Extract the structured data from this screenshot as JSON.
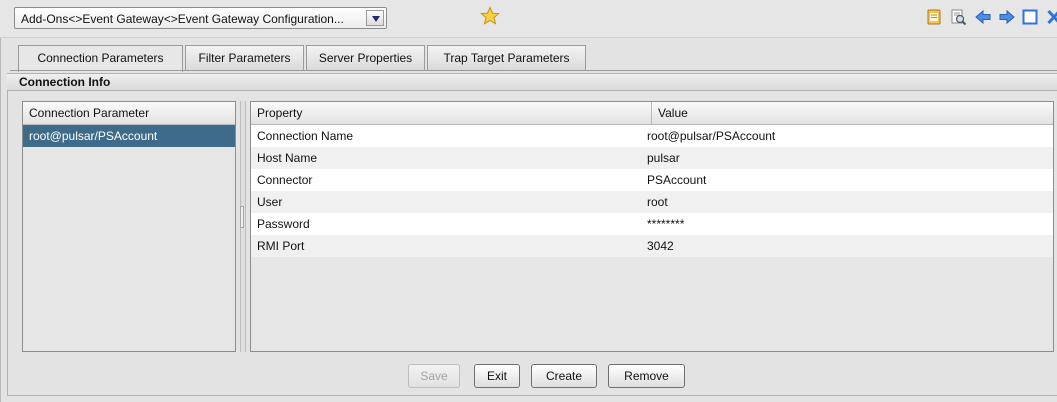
{
  "toolbar": {
    "breadcrumb": "Add-Ons<>Event Gateway<>Event Gateway Configuration...",
    "icons": [
      "star-icon",
      "notepad-icon",
      "print-preview-icon",
      "back-arrow-icon",
      "forward-arrow-icon",
      "maximize-icon",
      "close-icon"
    ]
  },
  "tabs": [
    {
      "label": "Connection Parameters",
      "active": true
    },
    {
      "label": "Filter Parameters",
      "active": false
    },
    {
      "label": "Server Properties",
      "active": false
    },
    {
      "label": "Trap Target Parameters",
      "active": false
    }
  ],
  "section": {
    "title": "Connection Info"
  },
  "left_list": {
    "header": "Connection Parameter",
    "items": [
      "root@pulsar/PSAccount"
    ],
    "selected": "root@pulsar/PSAccount"
  },
  "table": {
    "columns": [
      "Property",
      "Value"
    ],
    "rows": [
      {
        "property": "Connection Name",
        "value": "root@pulsar/PSAccount"
      },
      {
        "property": "Host Name",
        "value": "pulsar"
      },
      {
        "property": "Connector",
        "value": "PSAccount"
      },
      {
        "property": "User",
        "value": "root"
      },
      {
        "property": "Password",
        "value": "********"
      },
      {
        "property": "RMI Port",
        "value": "3042"
      }
    ]
  },
  "buttons": {
    "save": "Save",
    "exit": "Exit",
    "create": "Create",
    "remove": "Remove",
    "save_enabled": false
  },
  "colors": {
    "selection": "#3f6b8a",
    "accent_arrow": "#2f74d8",
    "star": "#f2c12e"
  }
}
